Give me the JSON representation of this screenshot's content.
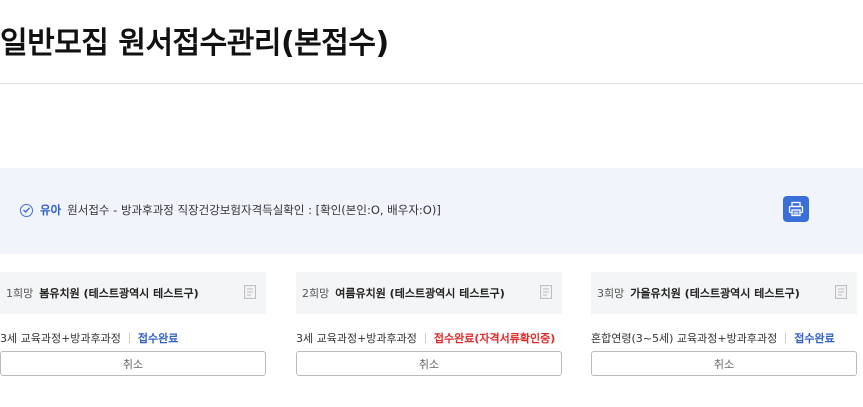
{
  "page": {
    "title": "일반모집 원서접수관리(본접수)"
  },
  "info": {
    "kind": "유아",
    "text": "원서접수 - 방과후과정 직장건강보험자격득실확인 : [확인(본인:O, 배우자:O)]"
  },
  "choices": [
    {
      "rank": "1희망",
      "school": "봄유치원 (테스트광역시 테스트구)",
      "course": "3세 교육과정+방과후과정",
      "status": "접수완료",
      "cancel_label": "취소"
    },
    {
      "rank": "2희망",
      "school": "여름유치원 (테스트광역시 테스트구)",
      "course": "3세 교육과정+방과후과정",
      "status": "접수완료(자격서류확인중)",
      "cancel_label": "취소"
    },
    {
      "rank": "3희망",
      "school": "가을유치원 (테스트광역시 테스트구)",
      "course": "혼합연령(3~5세) 교육과정+방과후과정",
      "status": "접수완료",
      "cancel_label": "취소"
    }
  ],
  "colors": {
    "accent": "#2f5fc9",
    "warning": "#e02b2b",
    "banner_bg": "#f1f5fb"
  },
  "icons": {
    "banner": "check-circle-icon",
    "print": "printer-icon",
    "document": "document-icon"
  }
}
